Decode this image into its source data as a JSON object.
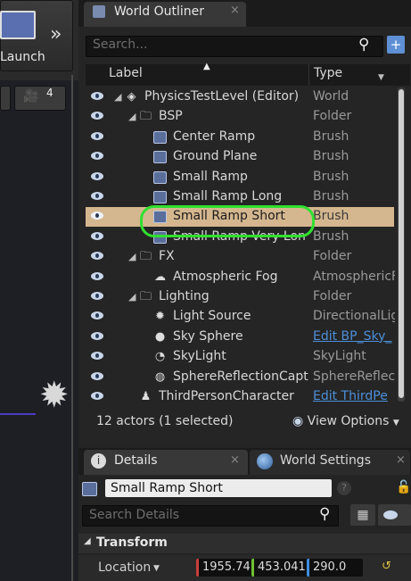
{
  "viewport": {
    "launch_label": "Launch",
    "chevron": "»",
    "camera_speed": "4"
  },
  "outliner": {
    "tab_title": "World Outliner",
    "tab_close": "×",
    "search_placeholder": "Search...",
    "columns": {
      "label": "Label",
      "type": "Type"
    },
    "rows": [
      {
        "label": "PhysicsTestLevel (Editor)",
        "type": "World",
        "icon": "world-icon",
        "indent": 0,
        "arrow": "◢",
        "selected": false,
        "link": false
      },
      {
        "label": "BSP",
        "type": "Folder",
        "icon": "folder-icon",
        "indent": 1,
        "arrow": "◢",
        "selected": false,
        "link": false
      },
      {
        "label": "Center Ramp",
        "type": "Brush",
        "icon": "brush-icon",
        "indent": 2,
        "selected": false,
        "link": false
      },
      {
        "label": "Ground Plane",
        "type": "Brush",
        "icon": "brush-icon",
        "indent": 2,
        "selected": false,
        "link": false
      },
      {
        "label": "Small Ramp",
        "type": "Brush",
        "icon": "brush-icon",
        "indent": 2,
        "selected": false,
        "link": false
      },
      {
        "label": "Small Ramp Long",
        "type": "Brush",
        "icon": "brush-icon",
        "indent": 2,
        "selected": false,
        "link": false
      },
      {
        "label": "Small Ramp Short",
        "type": "Brush",
        "icon": "brush-icon",
        "indent": 2,
        "selected": true,
        "link": false
      },
      {
        "label": "Small Ramp Very Lon",
        "type": "Brush",
        "icon": "brush-icon",
        "indent": 2,
        "selected": false,
        "link": false
      },
      {
        "label": "FX",
        "type": "Folder",
        "icon": "folder-icon",
        "indent": 1,
        "arrow": "◢",
        "selected": false,
        "link": false
      },
      {
        "label": "Atmospheric Fog",
        "type": "AtmosphericF",
        "icon": "fog-icon",
        "indent": 2,
        "selected": false,
        "link": false
      },
      {
        "label": "Lighting",
        "type": "Folder",
        "icon": "folder-icon",
        "indent": 1,
        "arrow": "◢",
        "selected": false,
        "link": false
      },
      {
        "label": "Light Source",
        "type": "DirectionalLig",
        "icon": "light-source-icon",
        "indent": 2,
        "selected": false,
        "link": false
      },
      {
        "label": "Sky Sphere",
        "type": "Edit BP_Sky_",
        "icon": "sky-sphere-icon",
        "indent": 2,
        "selected": false,
        "link": true
      },
      {
        "label": "SkyLight",
        "type": "SkyLight",
        "icon": "skylight-icon",
        "indent": 2,
        "selected": false,
        "link": false
      },
      {
        "label": "SphereReflectionCapt",
        "type": "SphereReflec",
        "icon": "reflection-capture-icon",
        "indent": 2,
        "selected": false,
        "link": false
      },
      {
        "label": "ThirdPersonCharacter",
        "type": "Edit ThirdPe",
        "icon": "character-icon",
        "indent": 1,
        "selected": false,
        "link": true
      }
    ],
    "actor_count": "12 actors (1 selected)",
    "view_options": "View Options"
  },
  "details": {
    "tab_title": "Details",
    "tab_close": "×",
    "world_settings_tab": "World Settings",
    "world_settings_close": "×",
    "object_name": "Small Ramp Short",
    "search_placeholder": "Search Details",
    "section": "Transform",
    "location_label": "Location",
    "location": {
      "x": "1955.74",
      "y": "453.041",
      "z": "290.0"
    }
  },
  "colors": {
    "selection": "#d5b78f",
    "highlight_circle": "#30e030",
    "link": "#4d8fd9"
  }
}
